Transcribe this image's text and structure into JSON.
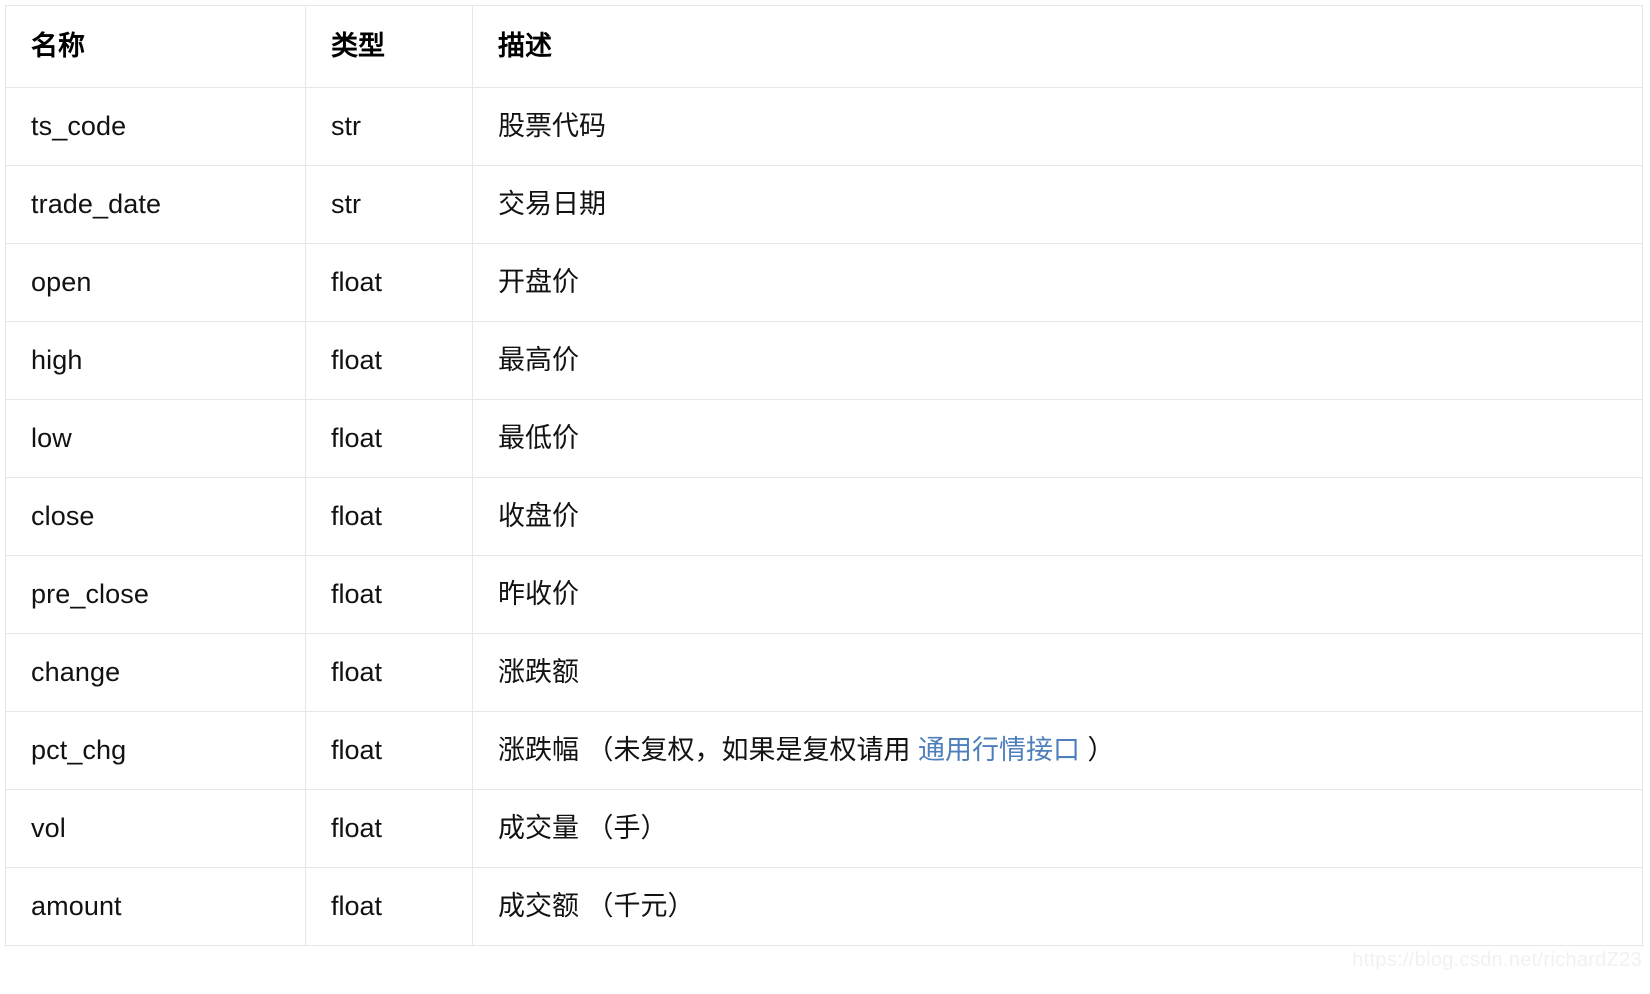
{
  "table": {
    "headers": [
      "名称",
      "类型",
      "描述"
    ],
    "rows": [
      {
        "name": "ts_code",
        "type": "str",
        "desc_prefix": "股票代码",
        "link": "",
        "desc_suffix": ""
      },
      {
        "name": "trade_date",
        "type": "str",
        "desc_prefix": "交易日期",
        "link": "",
        "desc_suffix": ""
      },
      {
        "name": "open",
        "type": "float",
        "desc_prefix": "开盘价",
        "link": "",
        "desc_suffix": ""
      },
      {
        "name": "high",
        "type": "float",
        "desc_prefix": "最高价",
        "link": "",
        "desc_suffix": ""
      },
      {
        "name": "low",
        "type": "float",
        "desc_prefix": "最低价",
        "link": "",
        "desc_suffix": ""
      },
      {
        "name": "close",
        "type": "float",
        "desc_prefix": "收盘价",
        "link": "",
        "desc_suffix": ""
      },
      {
        "name": "pre_close",
        "type": "float",
        "desc_prefix": "昨收价",
        "link": "",
        "desc_suffix": ""
      },
      {
        "name": "change",
        "type": "float",
        "desc_prefix": "涨跌额",
        "link": "",
        "desc_suffix": ""
      },
      {
        "name": "pct_chg",
        "type": "float",
        "desc_prefix": "涨跌幅 （未复权，如果是复权请用 ",
        "link": "通用行情接口",
        "desc_suffix": " ）"
      },
      {
        "name": "vol",
        "type": "float",
        "desc_prefix": "成交量 （手）",
        "link": "",
        "desc_suffix": ""
      },
      {
        "name": "amount",
        "type": "float",
        "desc_prefix": "成交额 （千元）",
        "link": "",
        "desc_suffix": ""
      }
    ]
  },
  "watermark": {
    "text": "https://blog.csdn.net/richardZ23"
  },
  "colors": {
    "link": "#4e7fbd",
    "border": "#e7e7e7",
    "text": "#121212",
    "watermark": "#f0f1f3"
  }
}
